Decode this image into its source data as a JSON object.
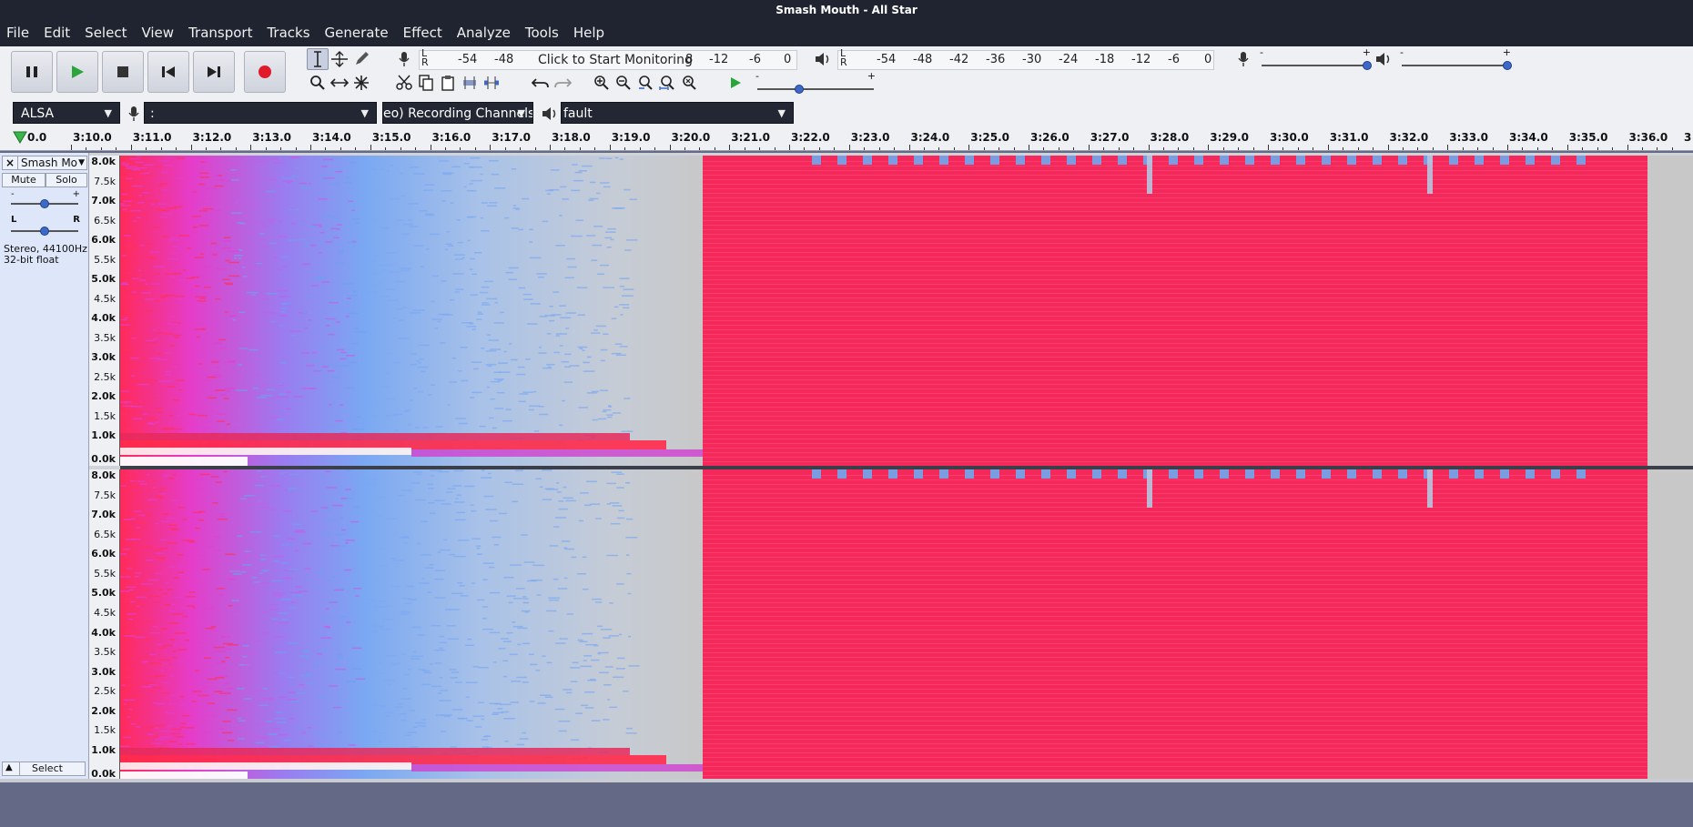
{
  "window": {
    "title": "Smash Mouth - All Star"
  },
  "menu": [
    "File",
    "Edit",
    "Select",
    "View",
    "Transport",
    "Tracks",
    "Generate",
    "Effect",
    "Analyze",
    "Tools",
    "Help"
  ],
  "transport": {
    "pause": "pause-icon",
    "play": "play-icon",
    "stop": "stop-icon",
    "skip_start": "skip-start-icon",
    "skip_end": "skip-end-icon",
    "record": "record-icon",
    "colors": {
      "play": "#2aa53a",
      "record": "#e0192b"
    }
  },
  "recording_meter": {
    "lr_label": "L\nR",
    "ticks": [
      "-54",
      "-48",
      "-12",
      "-6",
      "0"
    ],
    "monitor_text": "Click to Start Monitoring",
    "trailing_digit": "8"
  },
  "playback_meter": {
    "lr_label": "L\nR",
    "ticks": [
      "-54",
      "-48",
      "-42",
      "-36",
      "-30",
      "-24",
      "-18",
      "-12",
      "-6",
      "0"
    ]
  },
  "mixer": {
    "minus": "-",
    "plus": "+"
  },
  "play_at_speed": {
    "minus": "-",
    "plus": "+"
  },
  "devices": {
    "host": "ALSA",
    "recording_device": ":",
    "channels": "eo) Recording Channels",
    "playback_device": "fault"
  },
  "ruler": {
    "first_label": "0.0",
    "labels": [
      "3:10.0",
      "3:11.0",
      "3:12.0",
      "3:13.0",
      "3:14.0",
      "3:15.0",
      "3:16.0",
      "3:17.0",
      "3:18.0",
      "3:19.0",
      "3:20.0",
      "3:21.0",
      "3:22.0",
      "3:23.0",
      "3:24.0",
      "3:25.0",
      "3:26.0",
      "3:27.0",
      "3:28.0",
      "3:29.0",
      "3:30.0",
      "3:31.0",
      "3:32.0",
      "3:33.0",
      "3:34.0",
      "3:35.0",
      "3:36.0"
    ],
    "last_label": "3"
  },
  "track": {
    "close": "×",
    "name": "Smash Mou",
    "mute": "Mute",
    "solo": "Solo",
    "gain_minus": "-",
    "gain_plus": "+",
    "pan_left": "L",
    "pan_right": "R",
    "info_line1": "Stereo, 44100Hz",
    "info_line2": "32-bit float",
    "select": "Select"
  },
  "freq_axis": [
    {
      "label": "8.0k",
      "major": true
    },
    {
      "label": "7.5k",
      "major": false
    },
    {
      "label": "7.0k",
      "major": true
    },
    {
      "label": "6.5k",
      "major": false
    },
    {
      "label": "6.0k",
      "major": true
    },
    {
      "label": "5.5k",
      "major": false
    },
    {
      "label": "5.0k",
      "major": true
    },
    {
      "label": "4.5k",
      "major": false
    },
    {
      "label": "4.0k",
      "major": true
    },
    {
      "label": "3.5k",
      "major": false
    },
    {
      "label": "3.0k",
      "major": true
    },
    {
      "label": "2.5k",
      "major": false
    },
    {
      "label": "2.0k",
      "major": true
    },
    {
      "label": "1.5k",
      "major": false
    },
    {
      "label": "1.0k",
      "major": true
    },
    {
      "label": "0.0k",
      "major": true
    }
  ]
}
